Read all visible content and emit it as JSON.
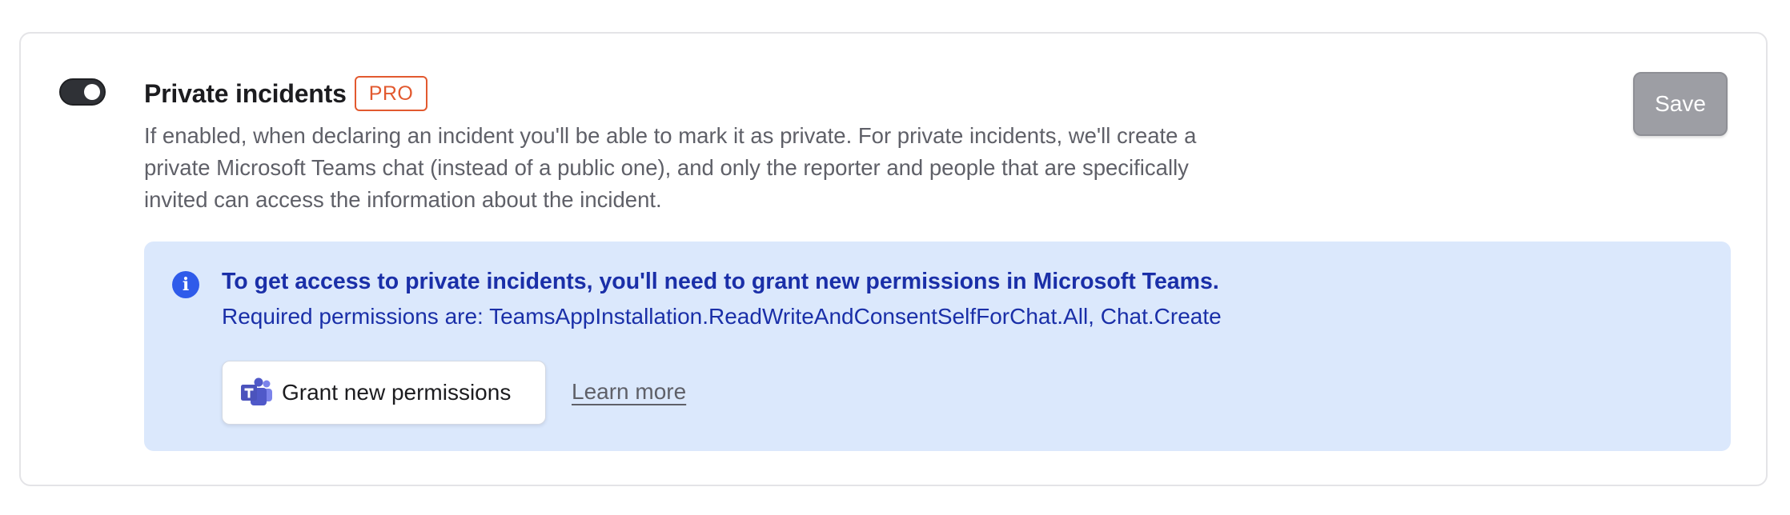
{
  "setting": {
    "title": "Private incidents",
    "badge": "PRO",
    "description": "If enabled, when declaring an incident you'll be able to mark it as private. For private incidents, we'll create a private Microsoft Teams chat (instead of a public one), and only the reporter and people that are specifically invited can access the information about the incident.",
    "toggle_enabled": true
  },
  "actions": {
    "save_label": "Save"
  },
  "notice": {
    "icon": "info-icon",
    "title": "To get access to private incidents, you'll need to grant new permissions in Microsoft Teams.",
    "permissions": "Required permissions are: TeamsAppInstallation.ReadWriteAndConsentSelfForChat.All, Chat.Create",
    "grant_button_label": "Grant new permissions",
    "grant_button_icon": "microsoft-teams-icon",
    "learn_more_label": "Learn more"
  },
  "colors": {
    "badge": "#e2592f",
    "notice_background": "#dbe8fc",
    "notice_text": "#1a2fa8",
    "info_icon": "#2f5bea",
    "save_button": "#9d9ea4"
  }
}
